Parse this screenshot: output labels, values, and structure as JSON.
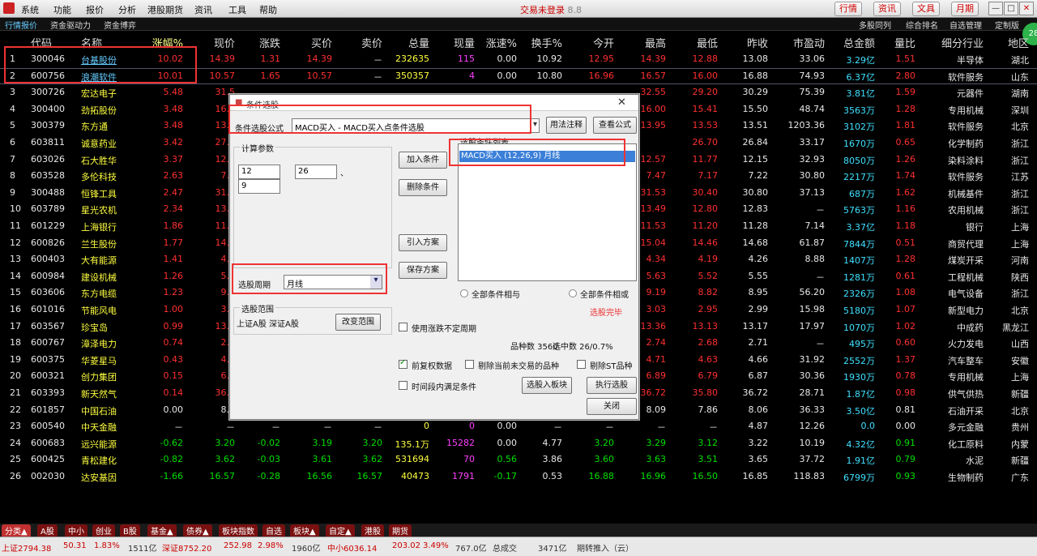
{
  "menu": {
    "items": [
      "系统",
      "功能",
      "报价",
      "分析",
      "港股期货",
      "资讯",
      "工具",
      "帮助"
    ],
    "title": "交易未登录",
    "version": "8.8",
    "top_buttons": [
      "行情",
      "资讯",
      "文具",
      "月期"
    ],
    "win": [
      "—",
      "□",
      "✕"
    ]
  },
  "subbar": {
    "left": [
      "行情报价",
      "资金驱动力",
      "资金博弈"
    ],
    "right": [
      "多股同列",
      "综合排名",
      "自选管理",
      "定制版"
    ]
  },
  "badge": "28",
  "columns": [
    "代码",
    "名称",
    "涨幅%",
    "现价",
    "涨跌",
    "买价",
    "卖价",
    "总量",
    "现量",
    "涨速%",
    "换手%",
    "今开",
    "最高",
    "最低",
    "昨收",
    "市盈动",
    "总金额",
    "量比",
    "细分行业",
    "地区"
  ],
  "rows": [
    {
      "n": "1",
      "code": "300046",
      "name": "台基股份",
      "chg": "10.02",
      "price": "14.39",
      "diff": "1.31",
      "bid": "14.39",
      "ask": "－",
      "vol": "232635",
      "cur": "115",
      "spd": "0.00",
      "turn": "10.92",
      "open": "12.95",
      "high": "14.39",
      "low": "12.88",
      "prev": "13.08",
      "pe": "33.06",
      "amt": "3.29亿",
      "vr": "1.51",
      "ind": "半导体",
      "area": "湖北"
    },
    {
      "n": "2",
      "code": "600756",
      "name": "浪潮软件",
      "chg": "10.01",
      "price": "10.57",
      "diff": "1.65",
      "bid": "10.57",
      "ask": "－",
      "vol": "350357",
      "cur": "4",
      "spd": "0.00",
      "turn": "10.80",
      "open": "16.96",
      "high": "16.57",
      "low": "16.00",
      "prev": "16.88",
      "pe": "74.93",
      "amt": "6.37亿",
      "vr": "2.80",
      "ind": "软件服务",
      "area": "山东"
    },
    {
      "n": "3",
      "code": "300726",
      "name": "宏达电子",
      "chg": "5.48",
      "price": "31.5",
      "diff": "",
      "bid": "",
      "ask": "",
      "vol": "",
      "cur": "",
      "spd": "",
      "turn": "",
      "open": "",
      "high": "32.55",
      "low": "29.20",
      "prev": "30.29",
      "pe": "75.39",
      "amt": "3.81亿",
      "vr": "1.59",
      "ind": "元器件",
      "area": "湖南"
    },
    {
      "n": "4",
      "code": "300400",
      "name": "劲拓股份",
      "chg": "3.48",
      "price": "16.0",
      "diff": "",
      "bid": "",
      "ask": "",
      "vol": "",
      "cur": "",
      "spd": "",
      "turn": "",
      "open": "",
      "high": "16.00",
      "low": "15.41",
      "prev": "15.50",
      "pe": "48.74",
      "amt": "3563万",
      "vr": "1.28",
      "ind": "专用机械",
      "area": "深圳"
    },
    {
      "n": "5",
      "code": "300379",
      "name": "东方通",
      "chg": "3.48",
      "price": "13.9",
      "diff": "",
      "bid": "",
      "ask": "",
      "vol": "",
      "cur": "",
      "spd": "",
      "turn": "",
      "open": "",
      "high": "13.95",
      "low": "13.53",
      "prev": "13.51",
      "pe": "1203.36",
      "amt": "3102万",
      "vr": "1.81",
      "ind": "软件服务",
      "area": "北京"
    },
    {
      "n": "6",
      "code": "603811",
      "name": "诚意药业",
      "chg": "3.42",
      "price": "27.7",
      "diff": "",
      "bid": "",
      "ask": "",
      "vol": "",
      "cur": "",
      "spd": "",
      "turn": "",
      "open": "",
      "high": "",
      "low": "26.70",
      "prev": "26.84",
      "pe": "33.17",
      "amt": "1670万",
      "vr": "0.65",
      "ind": "化学制药",
      "area": "浙江"
    },
    {
      "n": "7",
      "code": "603026",
      "name": "石大胜华",
      "chg": "3.37",
      "price": "12.5",
      "diff": "",
      "bid": "",
      "ask": "",
      "vol": "",
      "cur": "",
      "spd": "",
      "turn": "",
      "open": "",
      "high": "12.57",
      "low": "11.77",
      "prev": "12.15",
      "pe": "32.93",
      "amt": "8050万",
      "vr": "1.26",
      "ind": "染料涂料",
      "area": "浙江"
    },
    {
      "n": "8",
      "code": "603528",
      "name": "多伦科技",
      "chg": "2.63",
      "price": "7.4",
      "diff": "",
      "bid": "",
      "ask": "",
      "vol": "",
      "cur": "",
      "spd": "",
      "turn": "",
      "open": "",
      "high": "7.47",
      "low": "7.17",
      "prev": "7.22",
      "pe": "30.80",
      "amt": "2217万",
      "vr": "1.74",
      "ind": "软件服务",
      "area": "江苏"
    },
    {
      "n": "9",
      "code": "300488",
      "name": "恒锋工具",
      "chg": "2.47",
      "price": "31.5",
      "diff": "",
      "bid": "",
      "ask": "",
      "vol": "",
      "cur": "",
      "spd": "",
      "turn": "",
      "open": "",
      "high": "31.53",
      "low": "30.40",
      "prev": "30.80",
      "pe": "37.13",
      "amt": "687万",
      "vr": "1.62",
      "ind": "机械基件",
      "area": "浙江"
    },
    {
      "n": "10",
      "code": "603789",
      "name": "星光农机",
      "chg": "2.34",
      "price": "13.1",
      "diff": "",
      "bid": "",
      "ask": "",
      "vol": "",
      "cur": "",
      "spd": "",
      "turn": "",
      "open": "",
      "high": "13.49",
      "low": "12.80",
      "prev": "12.83",
      "pe": "－",
      "amt": "5763万",
      "vr": "1.16",
      "ind": "农用机械",
      "area": "浙江"
    },
    {
      "n": "11",
      "code": "601229",
      "name": "上海银行",
      "chg": "1.86",
      "price": "11.4",
      "diff": "",
      "bid": "",
      "ask": "",
      "vol": "",
      "cur": "",
      "spd": "",
      "turn": "",
      "open": "",
      "high": "11.53",
      "low": "11.20",
      "prev": "11.28",
      "pe": "7.14",
      "amt": "3.37亿",
      "vr": "1.18",
      "ind": "银行",
      "area": "上海"
    },
    {
      "n": "12",
      "code": "600826",
      "name": "兰生股份",
      "chg": "1.77",
      "price": "14.9",
      "diff": "",
      "bid": "",
      "ask": "",
      "vol": "",
      "cur": "",
      "spd": "",
      "turn": "",
      "open": "",
      "high": "15.04",
      "low": "14.46",
      "prev": "14.68",
      "pe": "61.87",
      "amt": "7844万",
      "vr": "0.51",
      "ind": "商贸代理",
      "area": "上海"
    },
    {
      "n": "13",
      "code": "600403",
      "name": "大有能源",
      "chg": "1.41",
      "price": "4.3",
      "diff": "",
      "bid": "",
      "ask": "",
      "vol": "",
      "cur": "",
      "spd": "",
      "turn": "",
      "open": "",
      "high": "4.34",
      "low": "4.19",
      "prev": "4.26",
      "pe": "8.88",
      "amt": "1407万",
      "vr": "1.28",
      "ind": "煤炭开采",
      "area": "河南"
    },
    {
      "n": "14",
      "code": "600984",
      "name": "建设机械",
      "chg": "1.26",
      "price": "5.6",
      "diff": "",
      "bid": "",
      "ask": "",
      "vol": "",
      "cur": "",
      "spd": "",
      "turn": "",
      "open": "",
      "high": "5.63",
      "low": "5.52",
      "prev": "5.55",
      "pe": "－",
      "amt": "1281万",
      "vr": "0.61",
      "ind": "工程机械",
      "area": "陕西"
    },
    {
      "n": "15",
      "code": "603606",
      "name": "东方电缆",
      "chg": "1.23",
      "price": "9.0",
      "diff": "",
      "bid": "",
      "ask": "",
      "vol": "",
      "cur": "",
      "spd": "",
      "turn": "",
      "open": "",
      "high": "9.19",
      "low": "8.82",
      "prev": "8.95",
      "pe": "56.20",
      "amt": "2326万",
      "vr": "1.08",
      "ind": "电气设备",
      "area": "浙江"
    },
    {
      "n": "16",
      "code": "601016",
      "name": "节能风电",
      "chg": "1.00",
      "price": "3.0",
      "diff": "",
      "bid": "",
      "ask": "",
      "vol": "",
      "cur": "",
      "spd": "",
      "turn": "",
      "open": "",
      "high": "3.03",
      "low": "2.95",
      "prev": "2.99",
      "pe": "15.98",
      "amt": "5180万",
      "vr": "1.07",
      "ind": "新型电力",
      "area": "北京"
    },
    {
      "n": "17",
      "code": "603567",
      "name": "珍宝岛",
      "chg": "0.99",
      "price": "13.3",
      "diff": "",
      "bid": "",
      "ask": "",
      "vol": "",
      "cur": "",
      "spd": "",
      "turn": "",
      "open": "",
      "high": "13.36",
      "low": "13.13",
      "prev": "13.17",
      "pe": "17.97",
      "amt": "1070万",
      "vr": "1.02",
      "ind": "中成药",
      "area": "黑龙江"
    },
    {
      "n": "18",
      "code": "600767",
      "name": "漳泽电力",
      "chg": "0.74",
      "price": "2.7",
      "diff": "",
      "bid": "",
      "ask": "",
      "vol": "",
      "cur": "",
      "spd": "",
      "turn": "",
      "open": "",
      "high": "2.74",
      "low": "2.68",
      "prev": "2.71",
      "pe": "－",
      "amt": "495万",
      "vr": "0.60",
      "ind": "火力发电",
      "area": "山西"
    },
    {
      "n": "19",
      "code": "600375",
      "name": "华菱星马",
      "chg": "0.43",
      "price": "4.6",
      "diff": "",
      "bid": "",
      "ask": "",
      "vol": "",
      "cur": "",
      "spd": "",
      "turn": "",
      "open": "",
      "high": "4.71",
      "low": "4.63",
      "prev": "4.66",
      "pe": "31.92",
      "amt": "2552万",
      "vr": "1.37",
      "ind": "汽车整车",
      "area": "安徽"
    },
    {
      "n": "20",
      "code": "600321",
      "name": "创力集团",
      "chg": "0.15",
      "price": "6.8",
      "diff": "",
      "bid": "",
      "ask": "",
      "vol": "",
      "cur": "",
      "spd": "",
      "turn": "",
      "open": "",
      "high": "6.89",
      "low": "6.79",
      "prev": "6.87",
      "pe": "30.36",
      "amt": "1930万",
      "vr": "0.78",
      "ind": "专用机械",
      "area": "上海"
    },
    {
      "n": "21",
      "code": "603393",
      "name": "新天然气",
      "chg": "0.14",
      "price": "36.7",
      "diff": "",
      "bid": "",
      "ask": "",
      "vol": "",
      "cur": "",
      "spd": "",
      "turn": "",
      "open": "",
      "high": "36.72",
      "low": "35.80",
      "prev": "36.72",
      "pe": "28.71",
      "amt": "1.87亿",
      "vr": "0.98",
      "ind": "供气供热",
      "area": "新疆"
    },
    {
      "n": "22",
      "code": "601857",
      "name": "中国石油",
      "chg": "0.00",
      "price": "8.0",
      "diff": "",
      "bid": "",
      "ask": "",
      "vol": "",
      "cur": "",
      "spd": "",
      "turn": "",
      "open": "",
      "high": "8.09",
      "low": "7.86",
      "prev": "8.06",
      "pe": "36.33",
      "amt": "3.50亿",
      "vr": "0.81",
      "ind": "石油开采",
      "area": "北京"
    },
    {
      "n": "23",
      "code": "600540",
      "name": "中天金融",
      "chg": "－",
      "price": "－",
      "diff": "－",
      "bid": "－",
      "ask": "－",
      "vol": "0",
      "cur": "0",
      "spd": "0.00",
      "turn": "－",
      "open": "－",
      "high": "－",
      "low": "－",
      "prev": "4.87",
      "pe": "12.26",
      "amt": "0.0",
      "vr": "0.00",
      "ind": "多元金融",
      "area": "贵州"
    },
    {
      "n": "24",
      "code": "600683",
      "name": "远兴能源",
      "chg": "-0.62",
      "price": "3.20",
      "diff": "-0.02",
      "bid": "3.19",
      "ask": "3.20",
      "vol": "135.1万",
      "cur": "15282",
      "spd": "0.00",
      "turn": "4.77",
      "open": "3.20",
      "high": "3.29",
      "low": "3.12",
      "prev": "3.22",
      "pe": "10.19",
      "amt": "4.32亿",
      "vr": "0.91",
      "ind": "化工原料",
      "area": "内蒙"
    },
    {
      "n": "25",
      "code": "600425",
      "name": "青松建化",
      "chg": "-0.82",
      "price": "3.62",
      "diff": "-0.03",
      "bid": "3.61",
      "ask": "3.62",
      "vol": "531694",
      "cur": "70",
      "spd": "0.56",
      "turn": "3.86",
      "open": "3.60",
      "high": "3.63",
      "low": "3.51",
      "prev": "3.65",
      "pe": "37.72",
      "amt": "1.91亿",
      "vr": "0.79",
      "ind": "水泥",
      "area": "新疆"
    },
    {
      "n": "26",
      "code": "002030",
      "name": "达安基因",
      "chg": "-1.66",
      "price": "16.57",
      "diff": "-0.28",
      "bid": "16.56",
      "ask": "16.57",
      "vol": "40473",
      "cur": "1791",
      "spd": "-0.17",
      "turn": "0.53",
      "open": "16.88",
      "high": "16.96",
      "low": "16.50",
      "prev": "16.85",
      "pe": "118.83",
      "amt": "6799万",
      "vr": "0.93",
      "ind": "生物制药",
      "area": "广东"
    }
  ],
  "dialog": {
    "title": "条件选股",
    "formula_label": "条件选股公式",
    "formula_value": "MACD买入    - MACD买入点条件选股",
    "btn_usage": "用法注释",
    "btn_view": "查看公式",
    "calc_group": "计算参数",
    "p1": "12",
    "p2": "26",
    "p3": "9",
    "btn_add": "加入条件",
    "btn_del": "删除条件",
    "btn_import": "引入方案",
    "btn_save": "保存方案",
    "list_group": "选股条件列表",
    "list_item": "MACD买入 (12,26,9) 月线",
    "period_label": "选股周期",
    "period_value": "月线",
    "radio1": "全部条件相与",
    "radio2": "全部条件相或",
    "done": "选股完毕",
    "range_group": "选股范围",
    "range_value": "上证A股 深证A股",
    "btn_range": "改变范围",
    "chk_unstable": "使用涨跌不定周期",
    "total": "品种数 3560",
    "selected": "选中数 26/0.7%",
    "chk_fq": "前复权数据",
    "chk_notrade": "剔除当前未交易的品种",
    "chk_st": "剔除ST品种",
    "chk_time": "时间段内满足条件",
    "btn_toblock": "选股入板块",
    "btn_exec": "执行选股",
    "btn_close": "关闭"
  },
  "bottom_tabs": [
    "分类▲",
    "A股",
    "中小",
    "创业",
    "B股",
    "基金▲",
    "债券▲",
    "板块指数",
    "自选",
    "板块▲",
    "自定▲",
    "港股",
    "期货"
  ],
  "status": {
    "sh": "上证2794.38",
    "sh_chg": "50.31",
    "sh_pct": "1.83%",
    "sh_amt": "1511亿",
    "sz": "深证8752.20",
    "sz_chg": "252.98",
    "sz_pct": "2.98%",
    "sz_amt": "1960亿",
    "zx": "中小6036.14",
    "zx_chg": "203.02",
    "zx_pct": "3.49%",
    "zx_amt": "767.0亿",
    "total": "总成交",
    "total_v": "3471亿",
    "conn": "期转推入（云）"
  }
}
